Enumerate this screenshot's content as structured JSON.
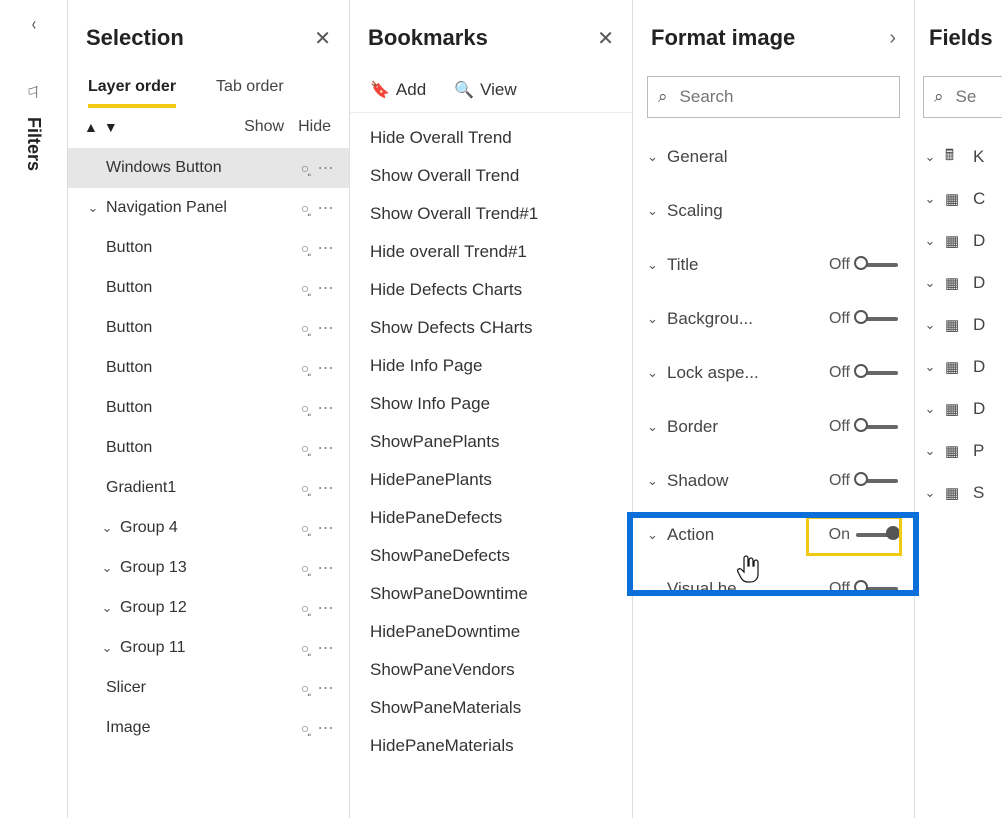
{
  "leftRail": {
    "label": "Filters"
  },
  "selection": {
    "title": "Selection",
    "tabs": {
      "layer": "Layer order",
      "tab": "Tab order"
    },
    "showhide": {
      "show": "Show",
      "hide": "Hide"
    },
    "items": [
      {
        "label": "Windows Button",
        "indent": 0,
        "expand": "",
        "selected": true
      },
      {
        "label": "Navigation Panel",
        "indent": 0,
        "expand": "down",
        "selected": false
      },
      {
        "label": "Button",
        "indent": 0,
        "expand": "",
        "selected": false
      },
      {
        "label": "Button",
        "indent": 0,
        "expand": "",
        "selected": false
      },
      {
        "label": "Button",
        "indent": 0,
        "expand": "",
        "selected": false
      },
      {
        "label": "Button",
        "indent": 0,
        "expand": "",
        "selected": false
      },
      {
        "label": "Button",
        "indent": 0,
        "expand": "",
        "selected": false
      },
      {
        "label": "Button",
        "indent": 0,
        "expand": "",
        "selected": false
      },
      {
        "label": "Gradient1",
        "indent": 0,
        "expand": "",
        "selected": false
      },
      {
        "label": "Group 4",
        "indent": 1,
        "expand": "down",
        "selected": false
      },
      {
        "label": "Group 13",
        "indent": 1,
        "expand": "down",
        "selected": false
      },
      {
        "label": "Group 12",
        "indent": 1,
        "expand": "down",
        "selected": false
      },
      {
        "label": "Group 11",
        "indent": 1,
        "expand": "down",
        "selected": false
      },
      {
        "label": "Slicer",
        "indent": 0,
        "expand": "",
        "selected": false
      },
      {
        "label": "Image",
        "indent": 0,
        "expand": "",
        "selected": false
      }
    ]
  },
  "bookmarks": {
    "title": "Bookmarks",
    "tools": {
      "add": "Add",
      "view": "View"
    },
    "items": [
      "Hide Overall Trend",
      "Show Overall Trend",
      "Show Overall Trend#1",
      "Hide overall Trend#1",
      "Hide Defects Charts",
      "Show Defects CHarts",
      "Hide Info Page",
      "Show Info Page",
      "ShowPanePlants",
      "HidePanePlants",
      "HidePaneDefects",
      "ShowPaneDefects",
      "ShowPaneDowntime",
      "HidePaneDowntime",
      "ShowPaneVendors",
      "ShowPaneMaterials",
      "HidePaneMaterials"
    ]
  },
  "format": {
    "title": "Format image",
    "search_placeholder": "Search",
    "rows": [
      {
        "label": "General",
        "toggle": null
      },
      {
        "label": "Scaling",
        "toggle": null
      },
      {
        "label": "Title",
        "toggle": "Off"
      },
      {
        "label": "Backgrou...",
        "toggle": "Off"
      },
      {
        "label": "Lock aspe...",
        "toggle": "Off"
      },
      {
        "label": "Border",
        "toggle": "Off"
      },
      {
        "label": "Shadow",
        "toggle": "Off"
      },
      {
        "label": "Action",
        "toggle": "On"
      },
      {
        "label": "Visual he...",
        "toggle": "Off"
      }
    ]
  },
  "fields": {
    "title": "Fields",
    "search_placeholder": "Se",
    "items": [
      {
        "icon": "calc",
        "label": "K"
      },
      {
        "icon": "table",
        "label": "C"
      },
      {
        "icon": "table",
        "label": "D"
      },
      {
        "icon": "table",
        "label": "D"
      },
      {
        "icon": "table",
        "label": "D"
      },
      {
        "icon": "table",
        "label": "D"
      },
      {
        "icon": "table",
        "label": "D"
      },
      {
        "icon": "table",
        "label": "P"
      },
      {
        "icon": "table",
        "label": "S"
      }
    ]
  }
}
